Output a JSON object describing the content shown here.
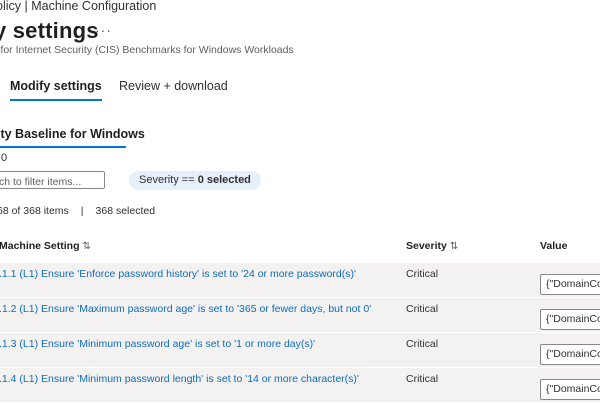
{
  "breadcrumb": "olicy | Machine Configuration",
  "page": {
    "title": "y settings",
    "more": "···",
    "subtitle": "r for Internet Security (CIS) Benchmarks for Windows Workloads"
  },
  "tabs": [
    {
      "label": "Modify settings",
      "active": true
    },
    {
      "label": "Review + download",
      "active": false
    }
  ],
  "section": {
    "tab_label": "ity Baseline for Windows",
    "version": ".0"
  },
  "filter": {
    "placeholder": "ch to filter items...",
    "severity_filter_prefix": "Severity == ",
    "severity_filter_value": "0 selected"
  },
  "counts": {
    "shown": "68 of 368 items",
    "separator": "|",
    "selected": "368 selected"
  },
  "table": {
    "headers": {
      "setting": "Machine Setting",
      "severity": "Severity",
      "value": "Value",
      "sort_glyph": "⇅"
    },
    "rows": [
      {
        "setting": ".1.1 (L1) Ensure 'Enforce password history' is set to '24 or more password(s)'",
        "severity": "Critical",
        "value": "{\"DomainCo"
      },
      {
        "setting": ".1.2 (L1) Ensure 'Maximum password age' is set to '365 or fewer days, but not 0'",
        "severity": "Critical",
        "value": "{\"DomainCo"
      },
      {
        "setting": ".1.3 (L1) Ensure 'Minimum password age' is set to '1 or more day(s)'",
        "severity": "Critical",
        "value": "{\"DomainCo"
      },
      {
        "setting": ".1.4 (L1) Ensure 'Minimum password length' is set to '14 or more character(s)'",
        "severity": "Critical",
        "value": "{\"DomainCo"
      }
    ]
  },
  "colors": {
    "accent": "#0078d4",
    "link": "#0f6cbd",
    "row_bg": "#f3f2f1",
    "pill_bg": "#e5f0fb"
  }
}
